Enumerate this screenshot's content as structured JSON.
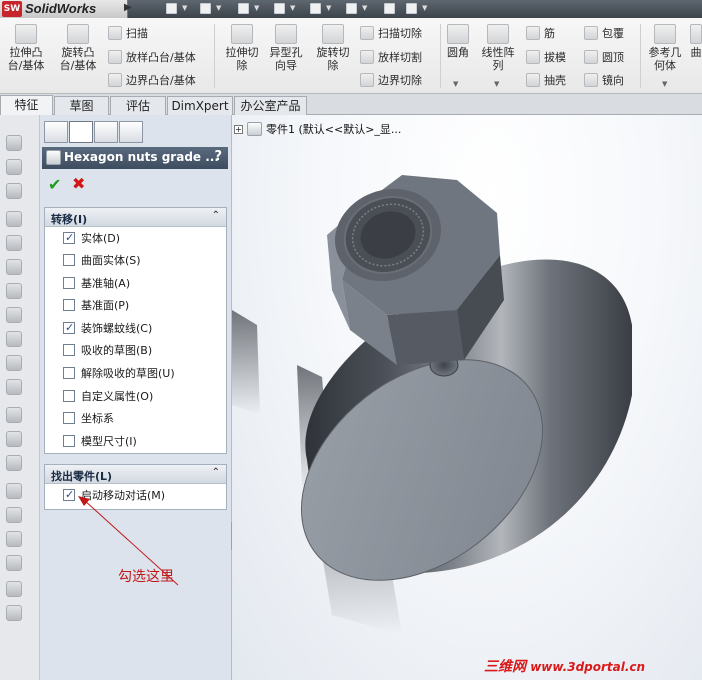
{
  "app": {
    "logo_text": "SW",
    "title": "SolidWorks"
  },
  "ribbon": {
    "extrude_boss": "拉伸凸\n台/基体",
    "revolve_boss": "旋转凸\n台/基体",
    "sweep": "扫描",
    "loft_boss": "放样凸台/基体",
    "boundary_boss": "边界凸台/基体",
    "extrude_cut": "拉伸切\n除",
    "hole_wizard": "异型孔\n向导",
    "revolve_cut": "旋转切\n除",
    "sweep_cut": "扫描切除",
    "loft_cut": "放样切割",
    "boundary_cut": "边界切除",
    "fillet": "圆角",
    "linear_pattern": "线性阵\n列",
    "rib": "筋",
    "draft": "拔模",
    "shell": "抽壳",
    "wrap": "包覆",
    "dome": "圆顶",
    "mirror": "镜向",
    "reference_geometry": "参考几\n何体",
    "curves": "曲"
  },
  "tabs": [
    "特征",
    "草图",
    "评估",
    "DimXpert",
    "办公室产品"
  ],
  "property_manager": {
    "title": "Hexagon nuts grade ...",
    "help": "?",
    "transfer_group": {
      "title": "转移(I)",
      "options": [
        {
          "label": "实体(D)",
          "checked": true
        },
        {
          "label": "曲面实体(S)",
          "checked": false
        },
        {
          "label": "基准轴(A)",
          "checked": false
        },
        {
          "label": "基准面(P)",
          "checked": false
        },
        {
          "label": "装饰螺蚊线(C)",
          "checked": true
        },
        {
          "label": "吸收的草图(B)",
          "checked": false
        },
        {
          "label": "解除吸收的草图(U)",
          "checked": false
        },
        {
          "label": "自定义属性(O)",
          "checked": false
        },
        {
          "label": "坐标系",
          "checked": false
        },
        {
          "label": "模型尺寸(I)",
          "checked": false
        }
      ]
    },
    "locate_group": {
      "title": "找出零件(L)",
      "options": [
        {
          "label": "启动移动对话(M)",
          "checked": true
        }
      ]
    }
  },
  "graphics": {
    "tree_label": "零件1 (默认<<默认>_显..."
  },
  "annotation": "勾选这里",
  "watermark": {
    "cn": "三维网",
    "url": "www.3dportal.cn"
  },
  "colors": {
    "annotation": "#c01818",
    "header": "#4a5a6e",
    "model": "#6d737c"
  }
}
